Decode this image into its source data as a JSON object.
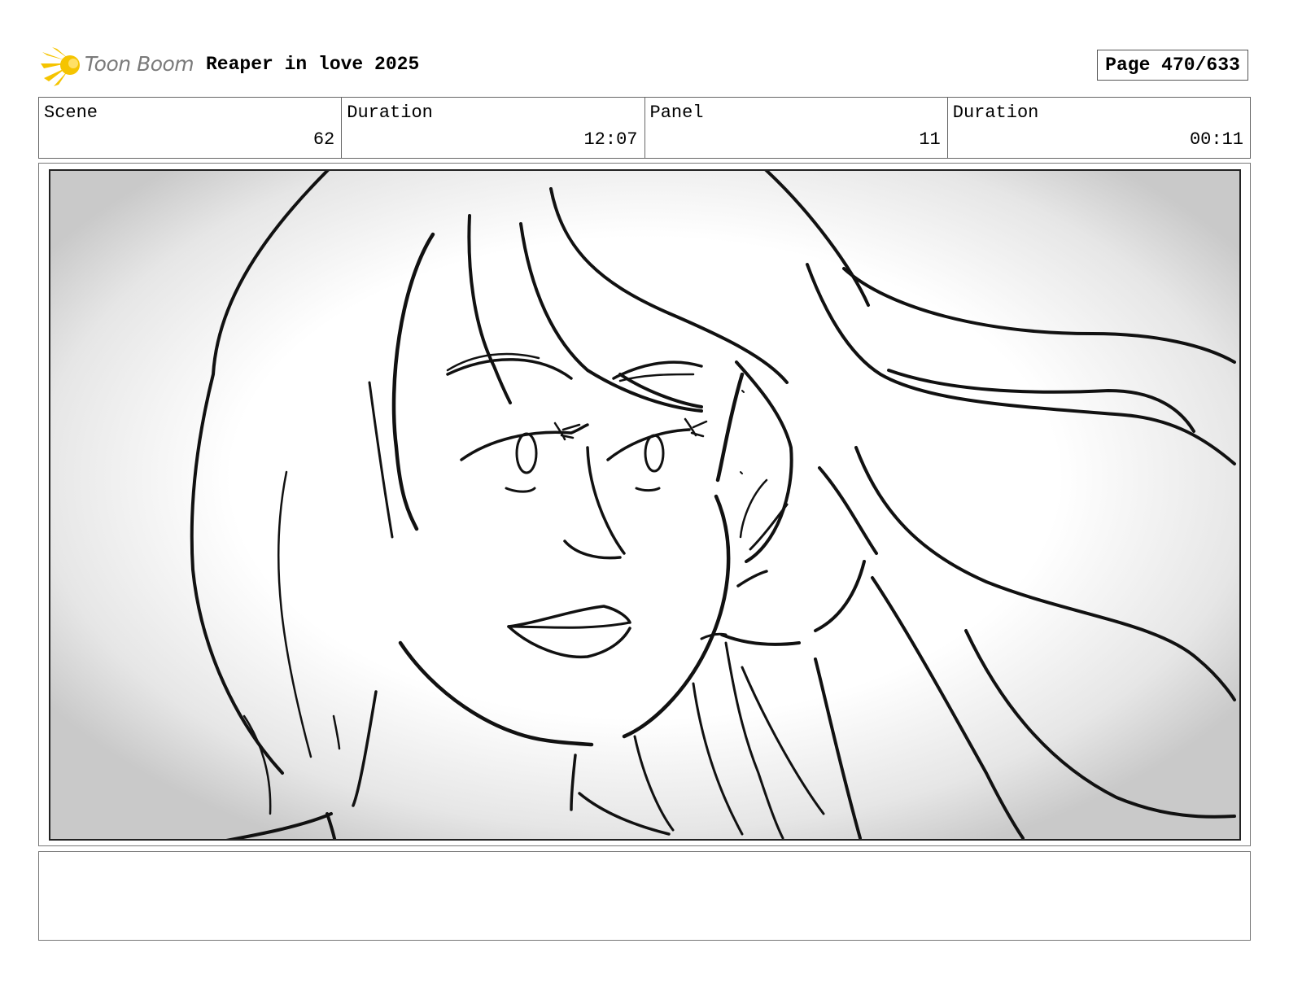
{
  "header": {
    "logo_text": "Toon Boom",
    "project_title": "Reaper in love 2025",
    "page_label": "Page 470/633"
  },
  "info": {
    "scene_label": "Scene",
    "scene_value": "62",
    "scene_duration_label": "Duration",
    "scene_duration_value": "12:07",
    "panel_label": "Panel",
    "panel_value": "11",
    "panel_duration_label": "Duration",
    "panel_duration_value": "00:11"
  },
  "colors": {
    "logo_accent": "#f5c400",
    "logo_text": "#7a7a7a"
  },
  "icons": {
    "logo": "toon-boom-star-icon"
  }
}
